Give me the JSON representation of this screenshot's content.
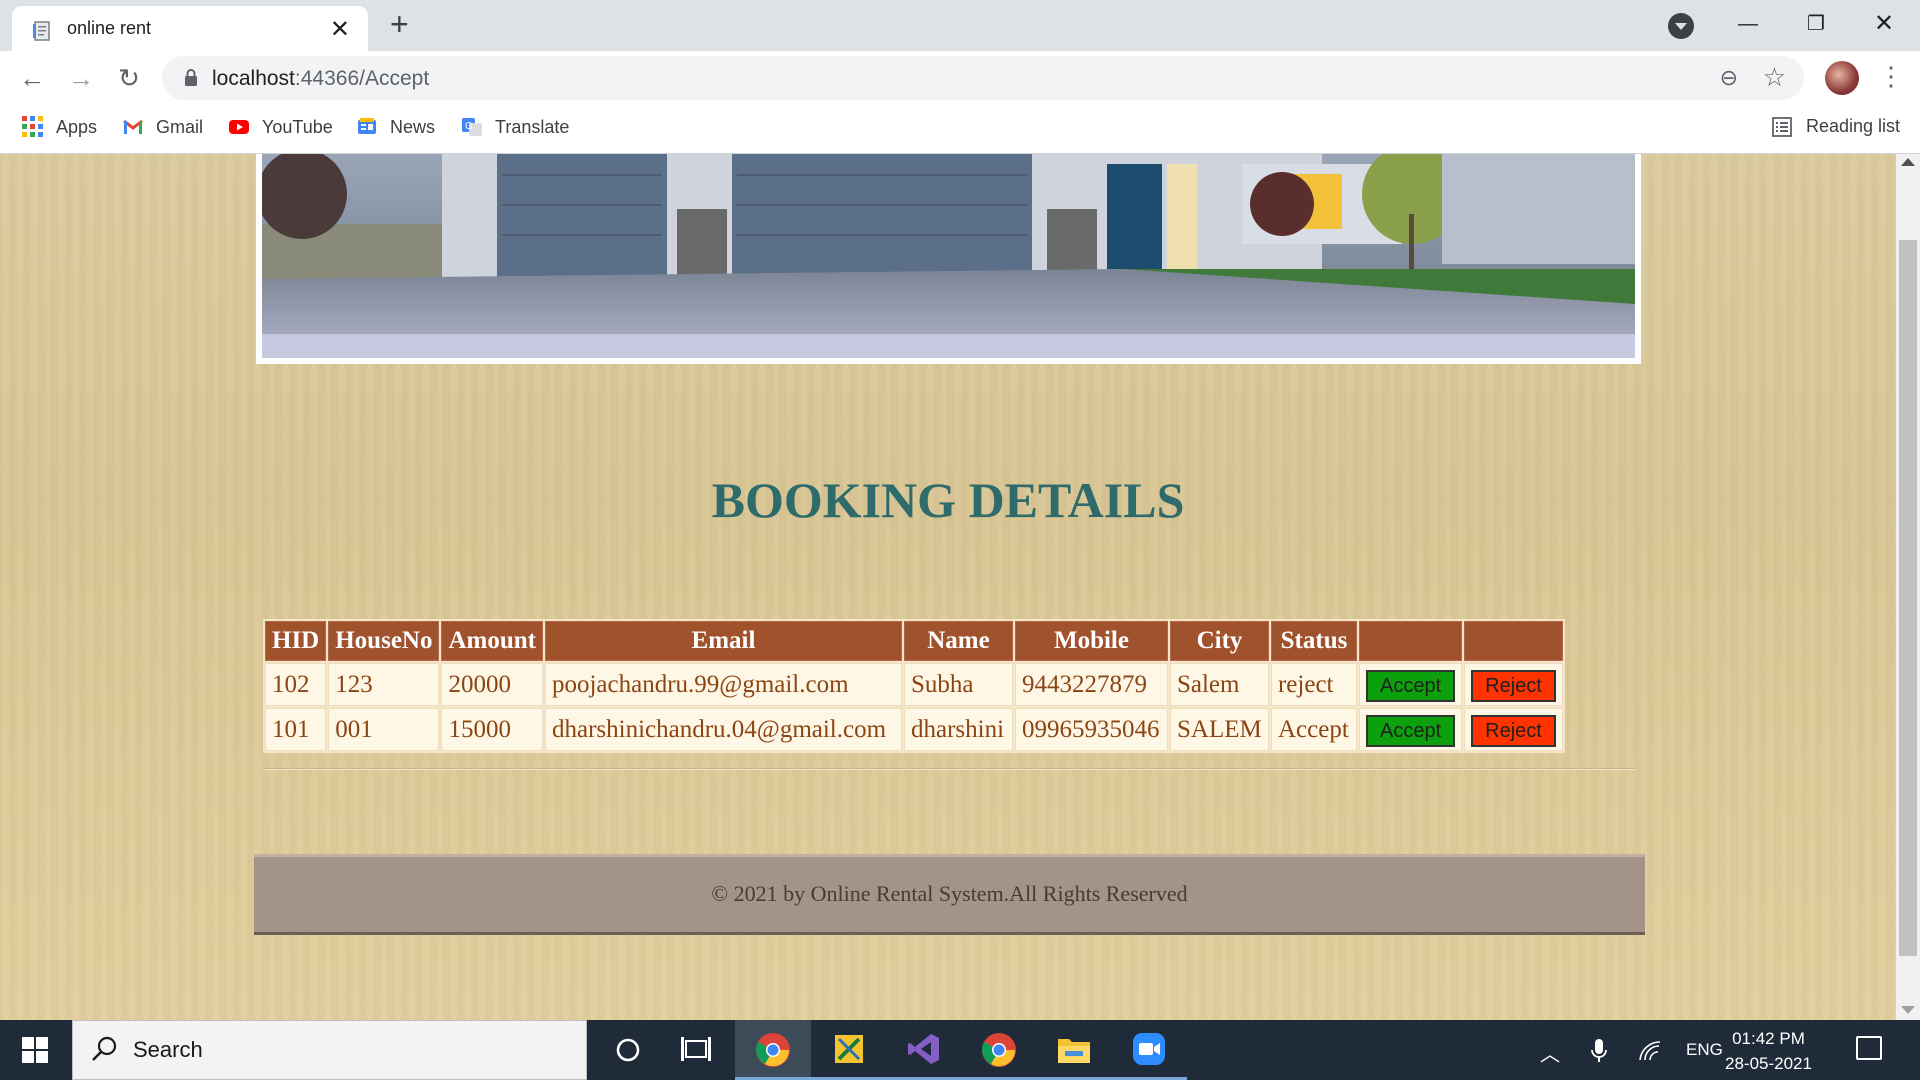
{
  "browser": {
    "tab_title": "online rent",
    "url_host": "localhost",
    "url_path": ":44366/Accept",
    "bookmarks": [
      {
        "label": "Apps",
        "icon": "apps-grid-icon"
      },
      {
        "label": "Gmail",
        "icon": "gmail-icon"
      },
      {
        "label": "YouTube",
        "icon": "youtube-icon"
      },
      {
        "label": "News",
        "icon": "news-icon"
      },
      {
        "label": "Translate",
        "icon": "translate-icon"
      }
    ],
    "reading_list": "Reading list"
  },
  "page": {
    "title": "BOOKING DETAILS",
    "table": {
      "headers": [
        "HID",
        "HouseNo",
        "Amount",
        "Email",
        "Name",
        "Mobile",
        "City",
        "Status",
        "",
        ""
      ],
      "rows": [
        {
          "hid": "102",
          "house_no": "123",
          "amount": "20000",
          "email": "poojachandru.99@gmail.com",
          "name": "Subha",
          "mobile": "9443227879",
          "city": "Salem",
          "status": "reject"
        },
        {
          "hid": "101",
          "house_no": "001",
          "amount": "15000",
          "email": "dharshinichandru.04@gmail.com",
          "name": "dharshini",
          "mobile": "09965935046",
          "city": "SALEM",
          "status": "Accept"
        }
      ],
      "accept_label": "Accept",
      "reject_label": "Reject"
    },
    "footer": "© 2021 by Online Rental System.All Rights Reserved"
  },
  "taskbar": {
    "search_placeholder": "Search",
    "language": "ENG",
    "time": "01:42 PM",
    "date": "28-05-2021"
  },
  "colors": {
    "header_bg": "#a0522d",
    "title": "#2f6b6b",
    "accept": "#0ca00c",
    "reject": "#ff3300",
    "footer_bg": "#a49488"
  }
}
